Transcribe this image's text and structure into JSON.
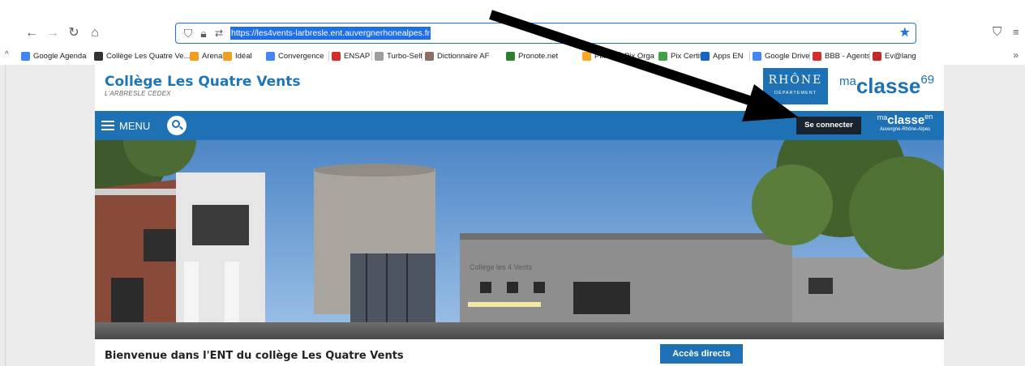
{
  "browser": {
    "url": "https://les4vents-larbresle.ent.auvergnerhonealpes.fr",
    "bookmarks": [
      {
        "label": "Google Agenda",
        "color": "#4285f4"
      },
      {
        "label": "Collège Les Quatre Ve...",
        "color": "#333333"
      },
      {
        "label": "Arena",
        "color": "#f0a020"
      },
      {
        "label": "Idéal",
        "color": "#f0a020"
      },
      {
        "label": "Convergence",
        "color": "#4285f4"
      },
      {
        "label": "ENSAP",
        "color": "#d32f2f"
      },
      {
        "label": "Turbo-Self",
        "color": "#9e9e9e"
      },
      {
        "label": "Dictionnaire AF",
        "color": "#8d6e63"
      },
      {
        "label": "Pronote.net",
        "color": "#2e7d32"
      },
      {
        "label": "Pix",
        "color": "#f9a825"
      },
      {
        "label": "Pix Orga",
        "color": "#1e88e5"
      },
      {
        "label": "Pix Certif",
        "color": "#43a047"
      },
      {
        "label": "Apps EN",
        "color": "#1565c0"
      },
      {
        "label": "Google Drive",
        "color": "#4285f4"
      },
      {
        "label": "BBB - Agents",
        "color": "#d32f2f"
      },
      {
        "label": "Ev@lang",
        "color": "#c62828"
      }
    ]
  },
  "site": {
    "school_name": "Collège Les Quatre Vents",
    "city": "L'ARBRESLE CEDEX",
    "rhone_logo": "RHÔNE",
    "rhone_sub": "DÉPARTEMENT",
    "maclasse69": {
      "prefix": "ma",
      "word": "classe",
      "suffix": "69"
    },
    "menu_label": "MENU",
    "login_label": "Se connecter",
    "maclasseen": {
      "prefix": "ma",
      "word": "classe",
      "suffix": "en",
      "region": "Auvergne-Rhône-Alpes"
    },
    "banner_sign": "Collège les 4 Vents",
    "welcome": "Bienvenue dans l'ENT du collège Les Quatre Vents",
    "acces_directs": "Accès directs"
  },
  "colors": {
    "brand_blue": "#1e71b5",
    "login_bg": "#1a2430",
    "url_highlight": "#1f6fe5"
  },
  "icons": [
    "back-arrow-icon",
    "forward-arrow-icon",
    "reload-icon",
    "home-icon",
    "shield-icon",
    "lock-icon",
    "permissions-icon",
    "star-icon",
    "pocket-icon",
    "extensions-icon",
    "search-icon",
    "hamburger-icon",
    "annotation-arrow"
  ]
}
